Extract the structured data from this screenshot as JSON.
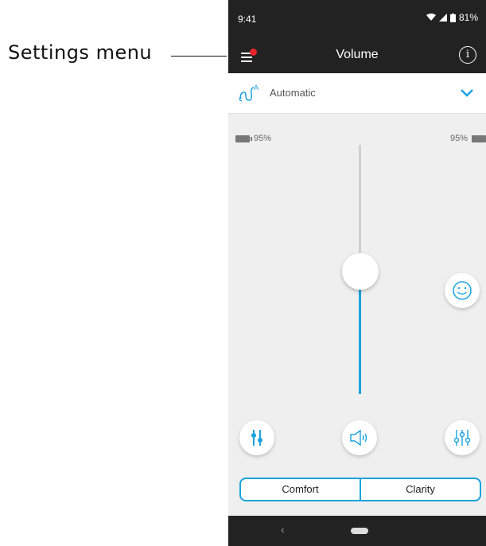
{
  "annotation": {
    "label": "Settings menu"
  },
  "status_bar": {
    "time": "9:41",
    "battery_percent": "81%"
  },
  "app_bar": {
    "title": "Volume",
    "menu_icon": "hamburger-icon",
    "info_icon": "info-icon",
    "notification_color": "#e8232a"
  },
  "program": {
    "label": "Automatic",
    "icon": "hearing-aid-automatic-icon"
  },
  "batteries": {
    "left": "95%",
    "right": "95%"
  },
  "volume_slider": {
    "level": 0.48
  },
  "buttons": {
    "smiley": "smiley-icon",
    "tune": "tune-icon",
    "speaker": "speaker-icon",
    "equalizer": "equalizer-icon"
  },
  "mode": {
    "options": [
      "Comfort",
      "Clarity"
    ]
  },
  "colors": {
    "accent": "#1aa3de",
    "dark": "#222222"
  }
}
